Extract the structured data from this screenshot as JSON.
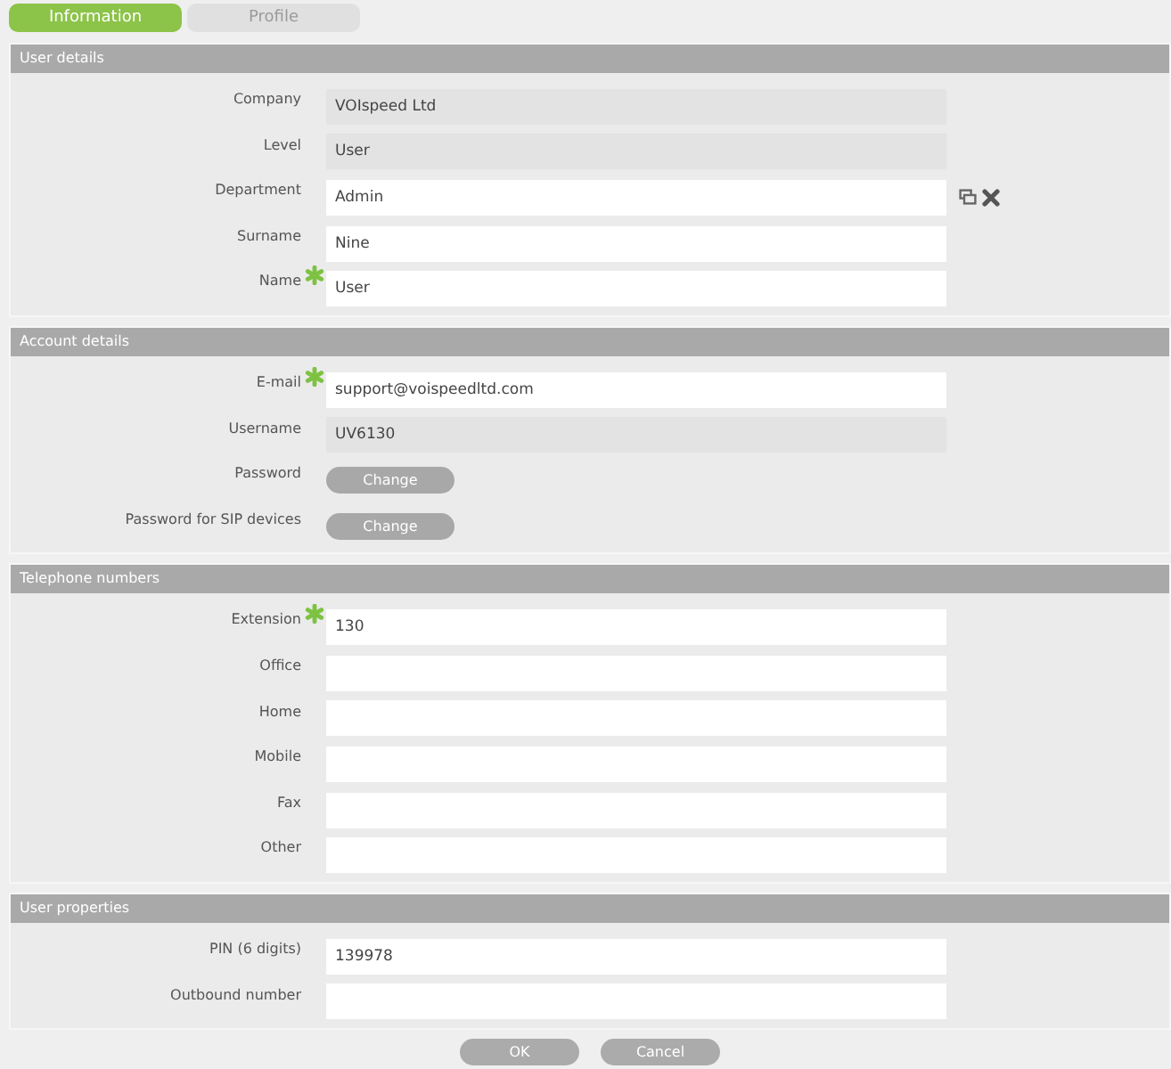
{
  "tabs": [
    {
      "label": "Information",
      "selected": true
    },
    {
      "label": "Profile",
      "selected": false
    }
  ],
  "sections": [
    {
      "title": "User details",
      "rows": [
        {
          "label": "Company",
          "kind": "readonly",
          "value": "VOIspeed Ltd",
          "required": false
        },
        {
          "label": "Level",
          "kind": "readonly",
          "value": "User",
          "required": false
        },
        {
          "label": "Department",
          "kind": "input",
          "value": "Admin",
          "required": false,
          "actions": true
        },
        {
          "label": "Surname",
          "kind": "input",
          "value": "Nine",
          "required": false
        },
        {
          "label": "Name",
          "kind": "input",
          "value": "User",
          "required": true
        }
      ]
    },
    {
      "title": "Account details",
      "rows": [
        {
          "label": "E-mail",
          "kind": "input",
          "value": "support@voispeedltd.com",
          "required": true
        },
        {
          "label": "Username",
          "kind": "readonly",
          "value": "UV6130",
          "required": false
        },
        {
          "label": "Password",
          "kind": "button",
          "value": "Change",
          "required": false
        },
        {
          "label": "Password for SIP devices",
          "kind": "button",
          "value": "Change",
          "required": false
        }
      ]
    },
    {
      "title": "Telephone numbers",
      "rows": [
        {
          "label": "Extension",
          "kind": "input",
          "value": "130",
          "required": true
        },
        {
          "label": "Office",
          "kind": "input",
          "required": false
        },
        {
          "label": "Home",
          "kind": "input",
          "required": false
        },
        {
          "label": "Mobile",
          "kind": "input",
          "required": false
        },
        {
          "label": "Fax",
          "kind": "input",
          "required": false
        },
        {
          "label": "Other",
          "kind": "input",
          "required": false
        }
      ]
    },
    {
      "title": "User properties",
      "rows": [
        {
          "label": "PIN (6 digits)",
          "kind": "input",
          "value": "139978",
          "required": false
        },
        {
          "label": "Outbound number",
          "kind": "input",
          "required": false
        }
      ]
    }
  ],
  "buttons": [
    "OK",
    "Cancel"
  ]
}
